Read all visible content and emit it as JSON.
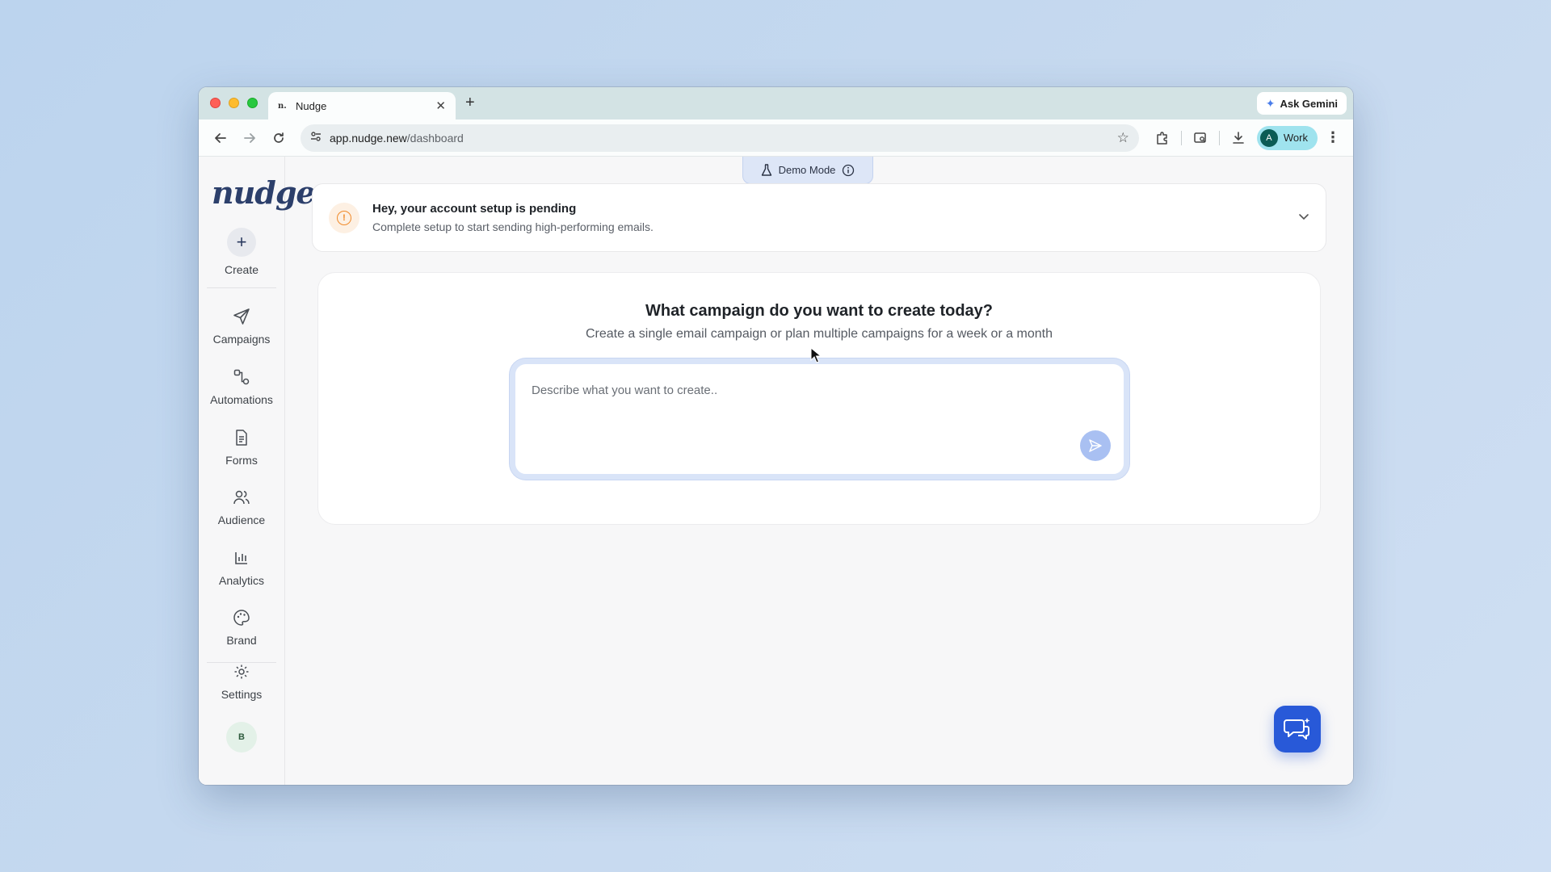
{
  "browser": {
    "tab_title": "Nudge",
    "tab_favicon": "n.",
    "new_tab": "+",
    "url_host": "app.nudge.new",
    "url_path": "/dashboard",
    "gemini_label": "Ask Gemini",
    "profile_initial": "A",
    "profile_label": "Work"
  },
  "app": {
    "logo": "nudge",
    "demo_label": "Demo Mode",
    "sidebar": {
      "create": "Create",
      "items": [
        {
          "label": "Campaigns",
          "icon": "send-icon"
        },
        {
          "label": "Automations",
          "icon": "workflow-icon"
        },
        {
          "label": "Forms",
          "icon": "document-icon"
        },
        {
          "label": "Audience",
          "icon": "users-icon"
        },
        {
          "label": "Analytics",
          "icon": "bar-chart-icon"
        },
        {
          "label": "Brand",
          "icon": "palette-icon"
        }
      ],
      "settings": "Settings",
      "user_initial": "B"
    },
    "banner": {
      "title": "Hey, your account setup is pending",
      "subtitle": "Complete setup to start sending high-performing emails."
    },
    "create_card": {
      "heading": "What campaign do you want to create today?",
      "subheading": "Create a single email campaign or plan multiple campaigns for a week or a month",
      "placeholder": "Describe what you want to create.."
    }
  },
  "colors": {
    "accent": "#2859d8",
    "send_button": "#a9c0f2",
    "warning": "#f08a2a"
  }
}
